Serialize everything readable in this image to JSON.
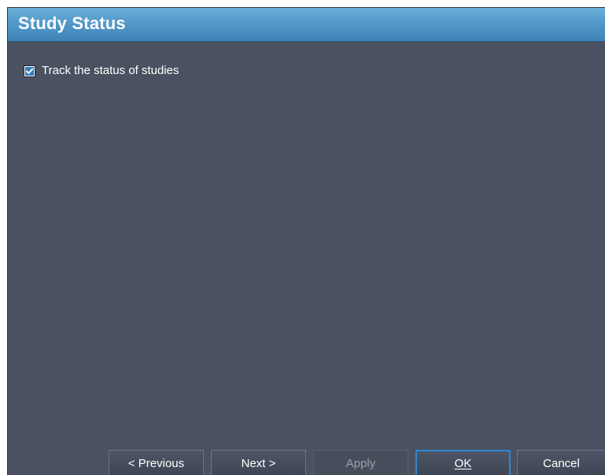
{
  "header": {
    "title": "Study Status"
  },
  "options": {
    "track_status": {
      "label": "Track the status of studies",
      "checked": true
    }
  },
  "buttons": {
    "previous": "< Previous",
    "next": "Next >",
    "apply": "Apply",
    "ok": "OK",
    "cancel": "Cancel"
  },
  "colors": {
    "panel_background": "#4a5160",
    "header_accent": "#4e95c6",
    "checkbox_fill": "#2f7ec0",
    "primary_button_border": "#2f86d1"
  }
}
